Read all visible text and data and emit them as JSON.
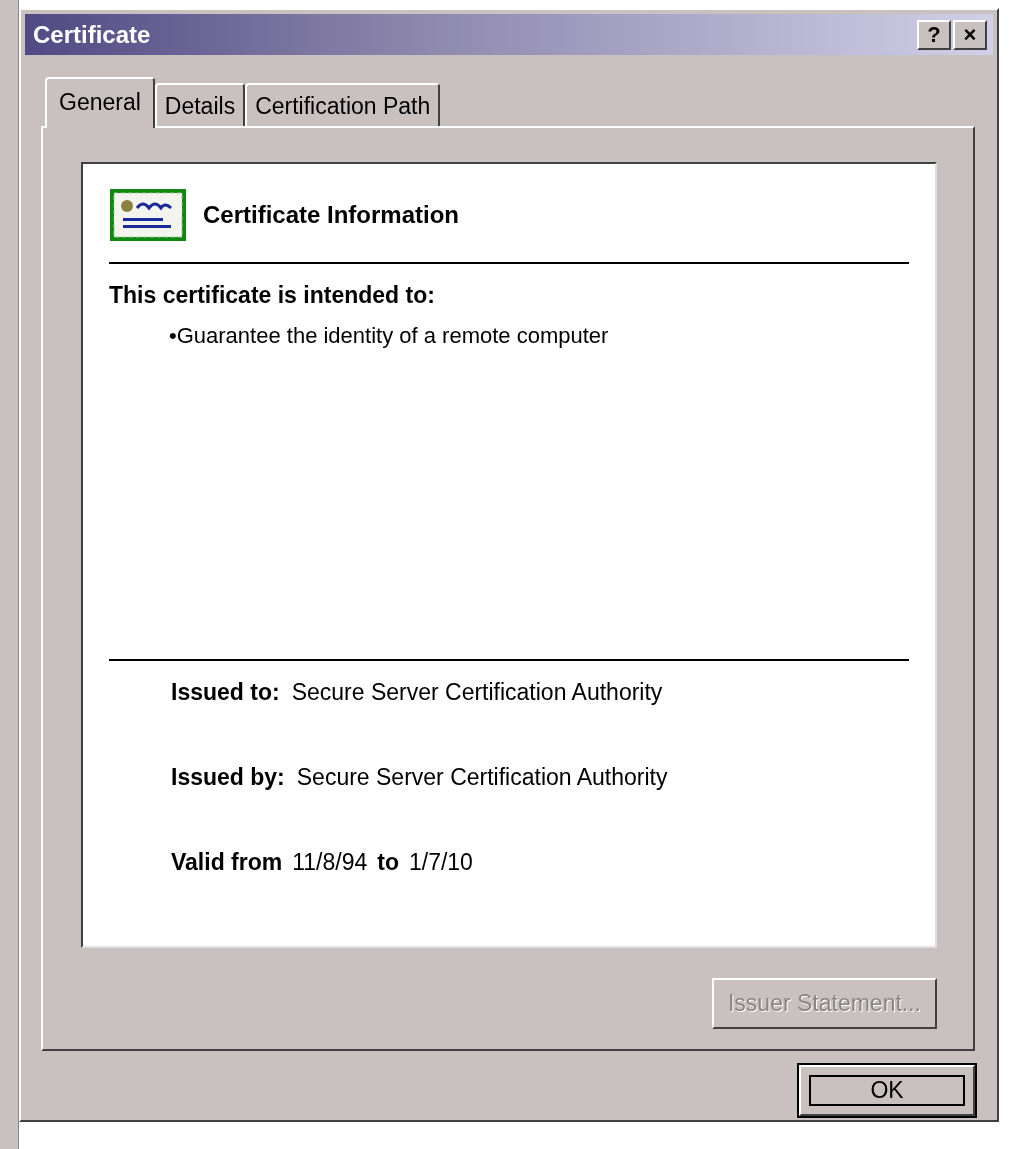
{
  "window": {
    "title": "Certificate",
    "help_button": "?",
    "close_button": "×"
  },
  "tabs": [
    {
      "label": "General",
      "selected": true
    },
    {
      "label": "Details",
      "selected": false
    },
    {
      "label": "Certification Path",
      "selected": false
    }
  ],
  "info": {
    "heading": "Certificate Information",
    "purpose_title": "This certificate is intended to:",
    "purposes": [
      "•Guarantee the identity of a remote computer"
    ],
    "fields": [
      {
        "label": "Issued to:",
        "value": "Secure Server Certification Authority"
      },
      {
        "label": "Issued by:",
        "value": "Secure Server Certification Authority"
      }
    ],
    "validity": {
      "from_label": "Valid from",
      "from": "11/8/94",
      "to_label": "to",
      "to": "1/7/10"
    }
  },
  "issuer_button": {
    "label": "Issuer Statement...",
    "disabled": true
  },
  "ok_button": {
    "label": "OK",
    "focused": true
  }
}
